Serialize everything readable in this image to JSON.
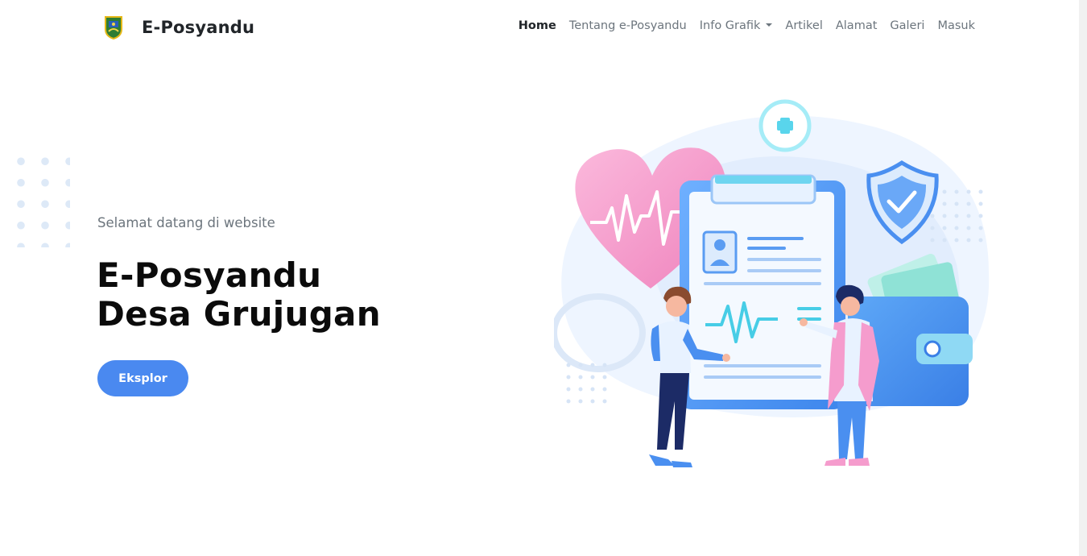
{
  "brand": {
    "name": "E-Posyandu",
    "logo_icon": "village-emblem-icon"
  },
  "nav": {
    "items": [
      {
        "label": "Home",
        "active": true
      },
      {
        "label": "Tentang e-Posyandu"
      },
      {
        "label": "Info Grafik",
        "dropdown": true
      },
      {
        "label": "Artikel"
      },
      {
        "label": "Alamat"
      },
      {
        "label": "Galeri"
      },
      {
        "label": "Masuk"
      }
    ]
  },
  "hero": {
    "subtitle": "Selamat datang di website",
    "title_line1": "E-Posyandu",
    "title_line2": "Desa Grujugan",
    "cta_label": "Eksplor"
  },
  "colors": {
    "primary": "#4a89f0",
    "text_dark": "#0b0b0b",
    "text_muted": "#6c757d",
    "heart_pink": "#f5a3cf",
    "accent_cyan": "#4fd4e8"
  }
}
